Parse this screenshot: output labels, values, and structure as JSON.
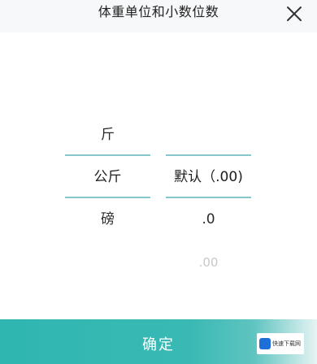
{
  "header": {
    "title": "体重单位和小数位数"
  },
  "icons": {
    "close": "close-icon"
  },
  "unit_picker": {
    "items": [
      "斤",
      "公斤",
      "磅"
    ],
    "selected": "公斤"
  },
  "decimal_picker": {
    "items": [
      "默认（.00)",
      ".0",
      ".00"
    ],
    "selected": "默认（.00)"
  },
  "footer": {
    "confirm_label": "确定"
  },
  "watermark": {
    "text": "快速下载网"
  },
  "colors": {
    "accent": "#2fb6b1",
    "selection_line": "#86c7cc"
  }
}
